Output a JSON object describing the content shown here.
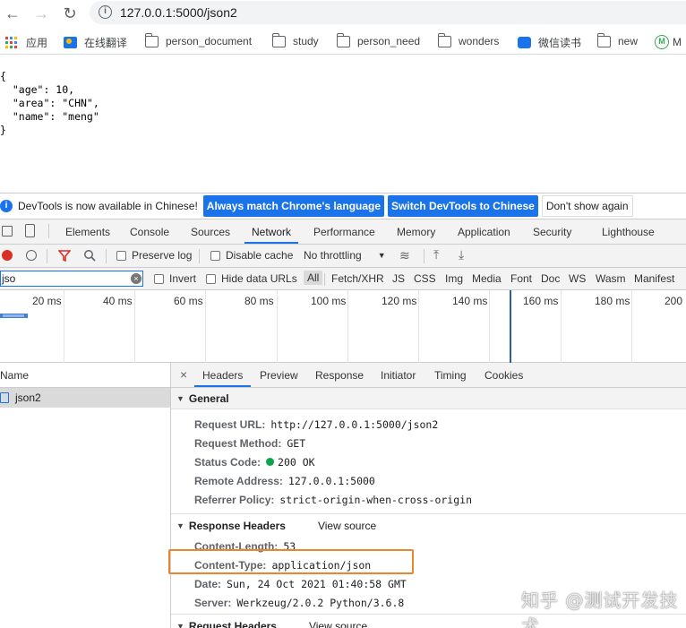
{
  "browser": {
    "url": "127.0.0.1:5000/json2",
    "bookmarks": [
      {
        "label": "应用",
        "icon": "apps-grid-icon"
      },
      {
        "label": "在线翻译",
        "icon": "translate-icon"
      },
      {
        "label": "person_document",
        "icon": "folder-icon"
      },
      {
        "label": "study",
        "icon": "folder-icon"
      },
      {
        "label": "person_need",
        "icon": "folder-icon"
      },
      {
        "label": "wonders",
        "icon": "folder-icon"
      },
      {
        "label": "微信读书",
        "icon": "weread-icon"
      },
      {
        "label": "new",
        "icon": "folder-icon"
      },
      {
        "label": "M",
        "icon": "medium-icon"
      }
    ]
  },
  "page": {
    "json_lines": [
      "{",
      "  \"age\": 10,",
      "  \"area\": \"CHN\",",
      "  \"name\": \"meng\"",
      "}"
    ]
  },
  "devtools": {
    "infobar": {
      "message": "DevTools is now available in Chinese!",
      "btn_match": "Always match Chrome's language",
      "btn_switch": "Switch DevTools to Chinese",
      "btn_dismiss": "Don't show again"
    },
    "tabs": [
      "Elements",
      "Console",
      "Sources",
      "Network",
      "Performance",
      "Memory",
      "Application",
      "Security",
      "Lighthouse"
    ],
    "active_tab": "Network",
    "toolbar": {
      "preserve_log": "Preserve log",
      "disable_cache": "Disable cache",
      "throttling": "No throttling"
    },
    "filter": {
      "value": "jso",
      "invert": "Invert",
      "hide_data_urls": "Hide data URLs",
      "types": [
        "All",
        "Fetch/XHR",
        "JS",
        "CSS",
        "Img",
        "Media",
        "Font",
        "Doc",
        "WS",
        "Wasm",
        "Manifest"
      ]
    },
    "timeline_ticks": [
      "20 ms",
      "40 ms",
      "60 ms",
      "80 ms",
      "100 ms",
      "120 ms",
      "140 ms",
      "160 ms",
      "180 ms",
      "200"
    ],
    "requests": {
      "header": "Name",
      "items": [
        "json2"
      ]
    },
    "detail": {
      "tabs": [
        "Headers",
        "Preview",
        "Response",
        "Initiator",
        "Timing",
        "Cookies"
      ],
      "general": {
        "title": "General",
        "rows": [
          {
            "k": "Request URL:",
            "v": "http://127.0.0.1:5000/json2"
          },
          {
            "k": "Request Method:",
            "v": "GET"
          },
          {
            "k": "Status Code:",
            "v": "200 OK"
          },
          {
            "k": "Remote Address:",
            "v": "127.0.0.1:5000"
          },
          {
            "k": "Referrer Policy:",
            "v": "strict-origin-when-cross-origin"
          }
        ]
      },
      "response_headers": {
        "title": "Response Headers",
        "view_source": "View source",
        "rows": [
          {
            "k": "Content-Length:",
            "v": "53"
          },
          {
            "k": "Content-Type:",
            "v": "application/json"
          },
          {
            "k": "Date:",
            "v": "Sun, 24 Oct 2021 01:40:58 GMT"
          },
          {
            "k": "Server:",
            "v": "Werkzeug/2.0.2 Python/3.6.8"
          }
        ]
      },
      "request_headers": {
        "title": "Request Headers",
        "view_source": "View source"
      }
    }
  },
  "watermark": "知乎 @测试开发技术"
}
